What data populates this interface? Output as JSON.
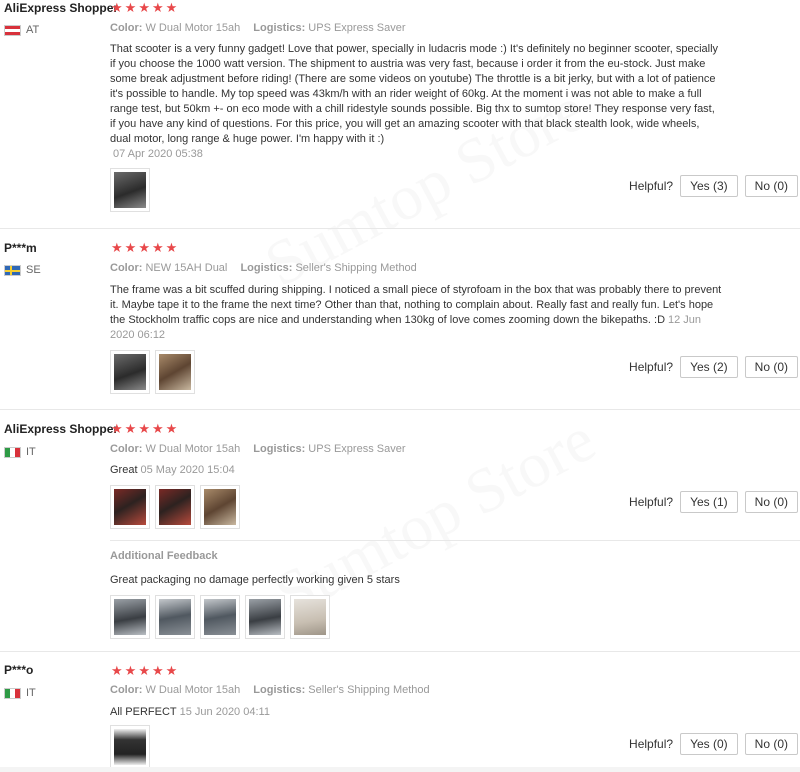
{
  "helpful_label": "Helpful?",
  "additional_label": "Additional Feedback",
  "color_label": "Color:",
  "logistics_label": "Logistics:",
  "watermark": "Sumtop Store",
  "reviews": [
    {
      "user": "AliExpress Shopper",
      "country": "AT",
      "stars": 5,
      "color": "W Dual Motor 15ah",
      "logistics": "UPS Express Saver",
      "text": "That scooter is a very funny gadget! Love that power, specially in ludacris mode :) It's definitely no beginner scooter, specially if you choose the 1000 watt version. The shipment to austria was very fast, because i order it from the eu-stock. Just make some break adjustment before riding! (There are some videos on youtube) The throttle is a bit jerky, but with a lot of patience it's possible to handle. My top speed was 43km/h with an rider weight of 60kg. At the moment i was not able to make a full range test, but 50km +- on eco mode with a chill ridestyle sounds possible. Big thx to sumtop store! They response very fast, if you have any kind of questions. For this price, you will get an amazing scooter with that black stealth look, wide wheels, dual motor, long range & huge power. I'm happy with it :)",
      "date": "07 Apr 2020 05:38",
      "yes": "Yes (3)",
      "no": "No (0)"
    },
    {
      "user": "P***m",
      "country": "SE",
      "stars": 5,
      "color": "NEW 15AH Dual",
      "logistics": "Seller's Shipping Method",
      "text": "The frame was a bit scuffed during shipping. I noticed a small piece of styrofoam in the box that was probably there to prevent it. Maybe tape it to the frame the next time? Other than that, nothing to complain about. Really fast and really fun. Let's hope the Stockholm traffic cops are nice and understanding when 130kg of love comes zooming down the bikepaths. :D",
      "date": "12 Jun 2020 06:12",
      "yes": "Yes (2)",
      "no": "No (0)"
    },
    {
      "user": "AliExpress Shopper",
      "country": "IT",
      "stars": 5,
      "color": "W Dual Motor 15ah",
      "logistics": "UPS Express Saver",
      "text": "Great",
      "date": "05 May 2020 15:04",
      "yes": "Yes (1)",
      "no": "No (0)",
      "additional": "Great packaging no damage perfectly working given 5 stars"
    },
    {
      "user": "P***o",
      "country": "IT",
      "stars": 5,
      "color": "W Dual Motor 15ah",
      "logistics": "Seller's Shipping Method",
      "text": "All PERFECT",
      "date": "15 Jun 2020 04:11",
      "yes": "Yes (0)",
      "no": "No (0)"
    }
  ]
}
